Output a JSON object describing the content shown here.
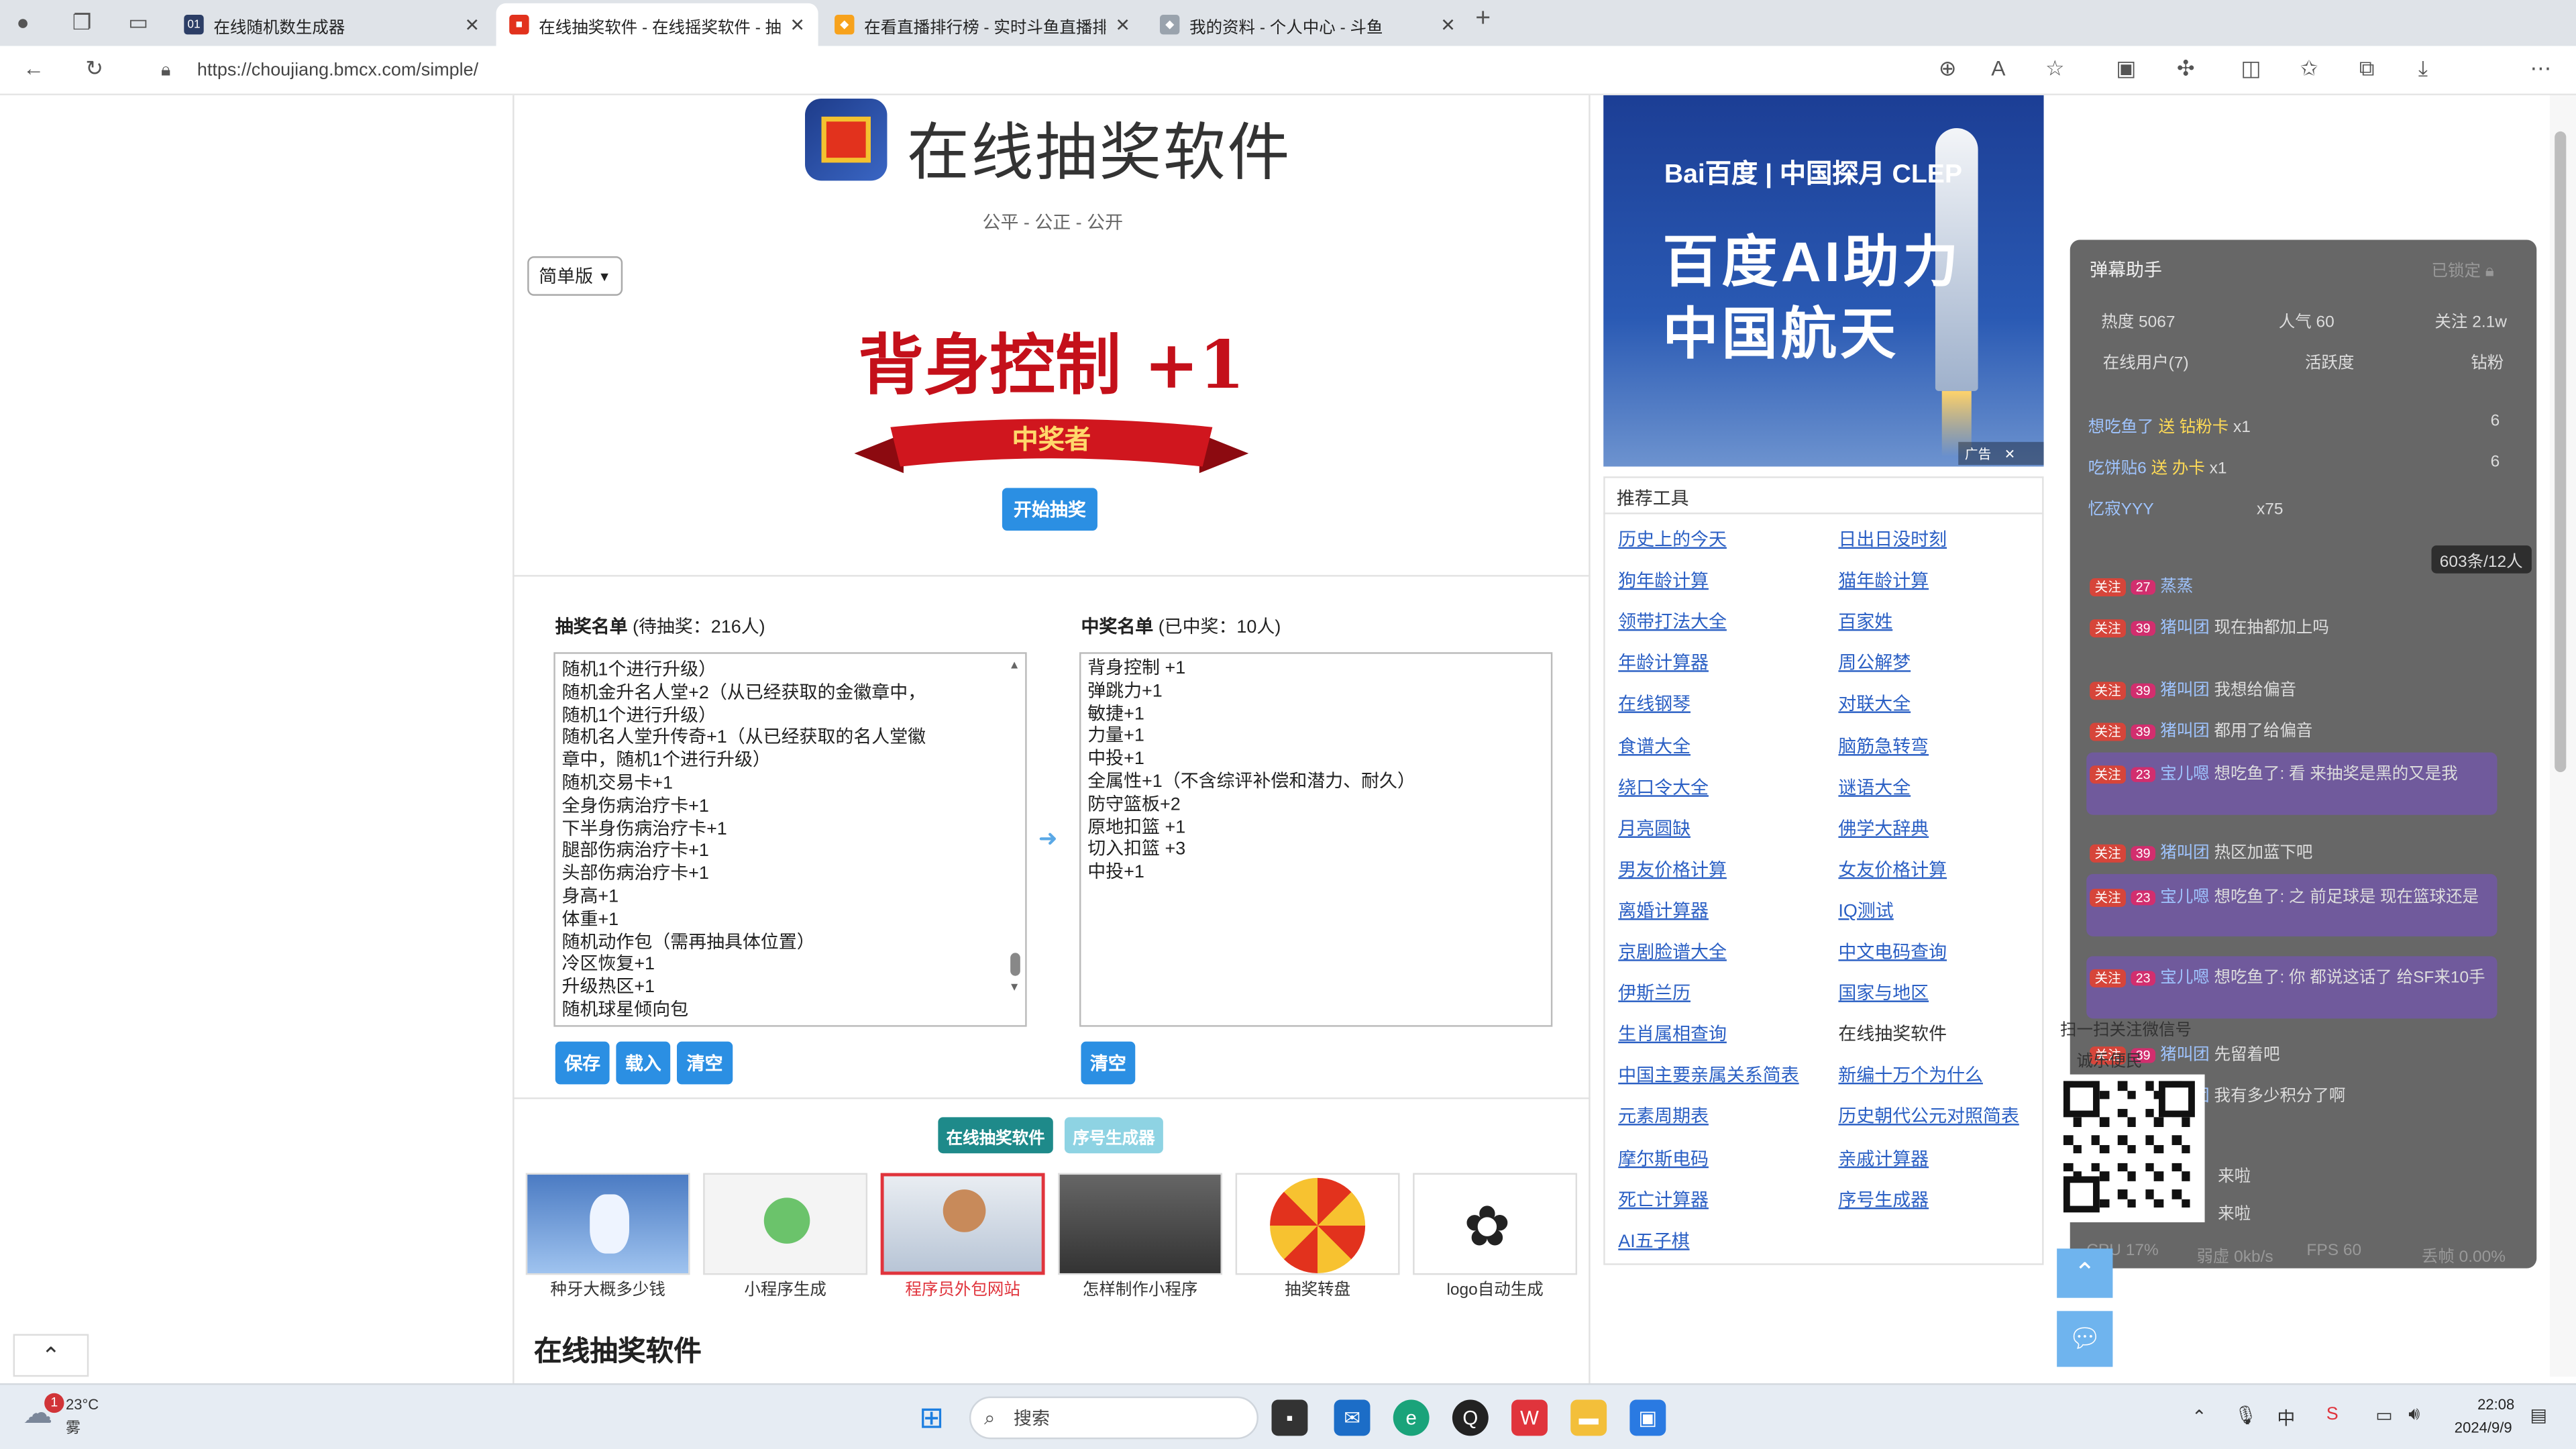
{
  "browser": {
    "tabs": [
      {
        "label": "在线随机数生成器",
        "icon": "01"
      },
      {
        "label": "在线抽奖软件 - 在线摇奖软件 - 抽",
        "icon": "gift"
      },
      {
        "label": "在看直播排行榜 - 实时斗鱼直播排",
        "icon": "fish"
      },
      {
        "label": "我的资料 - 个人中心 - 斗鱼",
        "icon": "fish"
      }
    ],
    "url": "https://choujiang.bmcx.com/simple/"
  },
  "page": {
    "site_title": "在线抽奖软件",
    "tagline": "公平 - 公正 - 公开",
    "version_select": "简单版",
    "winner_display": "背身控制 +1",
    "ribbon_text": "中奖者",
    "start_button": "开始抽奖",
    "draw_list_label": "抽奖名单",
    "draw_list_count": "(待抽奖：216人)",
    "draw_list": [
      "随机1个进行升级）",
      "随机金升名人堂+2（从已经获取的金徽章中，",
      "随机1个进行升级）",
      "随机名人堂升传奇+1（从已经获取的名人堂徽",
      "章中，随机1个进行升级）",
      "随机交易卡+1",
      "全身伤病治疗卡+1",
      "下半身伤病治疗卡+1",
      "腿部伤病治疗卡+1",
      "头部伤病治疗卡+1",
      "身高+1",
      "体重+1",
      "随机动作包（需再抽具体位置）",
      "冷区恢复+1",
      "升级热区+1",
      "随机球星倾向包"
    ],
    "winners_label": "中奖名单",
    "winners_count": "(已中奖：10人)",
    "winners": [
      "背身控制  +1",
      "弹跳力+1",
      "敏捷+1",
      "力量+1",
      "中投+1",
      "全属性+1（不含综评补偿和潜力、耐久）",
      "防守篮板+2",
      "原地扣篮  +1",
      "切入扣篮  +3",
      "中投+1"
    ],
    "save_button": "保存",
    "load_button": "载入",
    "clear_button": "清空",
    "clear_winners_button": "清空",
    "nav_active": "在线抽奖软件",
    "nav_other": "序号生成器",
    "thumbnails": [
      "种牙大概多少钱",
      "小程序生成",
      "程序员外包网站",
      "怎样制作小程序",
      "抽奖转盘",
      "logo自动生成"
    ],
    "bottom_title": "在线抽奖软件"
  },
  "ad": {
    "brand": "Bai百度 | 中国探月 CLEP",
    "line1": "百度AI助力",
    "line2": "中国航天",
    "tag": "广告"
  },
  "tools": {
    "title": "推荐工具",
    "left": [
      "历史上的今天",
      "狗年龄计算",
      "领带打法大全",
      "年龄计算器",
      "在线钢琴",
      "食谱大全",
      "绕口令大全",
      "月亮圆缺",
      "男友价格计算",
      "离婚计算器",
      "京剧脸谱大全",
      "伊斯兰历",
      "生肖属相查询",
      "中国主要亲属关系简表",
      "元素周期表",
      "摩尔斯电码",
      "死亡计算器",
      "AI五子棋"
    ],
    "right": [
      "日出日没时刻",
      "猫年龄计算",
      "百家姓",
      "周公解梦",
      "对联大全",
      "脑筋急转弯",
      "谜语大全",
      "佛学大辞典",
      "女友价格计算",
      "IQ测试",
      "中文电码查询",
      "国家与地区",
      "在线抽奖软件",
      "新编十万个为什么",
      "历史朝代公元对照简表",
      "亲戚计算器",
      "序号生成器"
    ]
  },
  "danmu": {
    "title": "弹幕助手",
    "locked": "已锁定",
    "stats": [
      "热度 5067",
      "人气 60",
      "关注 2.1w"
    ],
    "tabs": [
      "在线用户(7)",
      "活跃度",
      "钻粉"
    ],
    "gifts": [
      {
        "user": "想吃鱼了",
        "action": "送 钻粉卡",
        "count": "x1",
        "likes": "6"
      },
      {
        "user": "吃饼贴6",
        "action": "送 办卡",
        "count": "x1",
        "likes": "6"
      },
      {
        "user": "忆寂YYY",
        "action": "",
        "count": "x75",
        "likes": ""
      }
    ],
    "viewer_count": "603条/12人",
    "messages": [
      {
        "tag": "关注",
        "lv": "27",
        "name": "蒸蒸",
        "text": ""
      },
      {
        "tag": "关注",
        "lv": "39",
        "name": "猪叫团",
        "text": "现在抽都加上吗"
      },
      {
        "tag": "关注",
        "lv": "39",
        "name": "猪叫团",
        "text": "我想给偏音"
      },
      {
        "tag": "关注",
        "lv": "39",
        "name": "猪叫团",
        "text": "都用了给偏音"
      },
      {
        "tag": "关注",
        "lv": "23",
        "name": "宝儿嗯",
        "text": "想吃鱼了: 看 来抽奖是黑的又是我"
      },
      {
        "tag": "关注",
        "lv": "39",
        "name": "猪叫团",
        "text": "热区加蓝下吧"
      },
      {
        "tag": "关注",
        "lv": "23",
        "name": "宝儿嗯",
        "text": "想吃鱼了: 之 前足球是 现在篮球还是"
      },
      {
        "tag": "关注",
        "lv": "23",
        "name": "宝儿嗯",
        "text": "想吃鱼了: 你 都说这话了 给SF来10手"
      },
      {
        "tag": "关注",
        "lv": "39",
        "name": "猪叫团",
        "text": "先留着吧"
      },
      {
        "tag": "关注",
        "lv": "39",
        "name": "猪叫团",
        "text": "我有多少积分了啊"
      }
    ],
    "qr_caption": "扫一扫关注微信号",
    "qr_sub": "诚乐便民",
    "arrivals": [
      "来啦",
      "来啦"
    ],
    "footer": [
      "CPU 17%",
      "弱虚 0kb/s",
      "FPS 60",
      "丢帧 0.00%"
    ]
  },
  "taskbar": {
    "weather": "23°C",
    "weather_desc": "雾",
    "notif": "1",
    "search": "搜索",
    "time": "22:08",
    "date": "2024/9/9"
  },
  "colors": {
    "accent": "#2b8fe3",
    "winner_red": "#c4101a",
    "link": "#2a5fc4",
    "nav_active": "#1e8a8a"
  }
}
